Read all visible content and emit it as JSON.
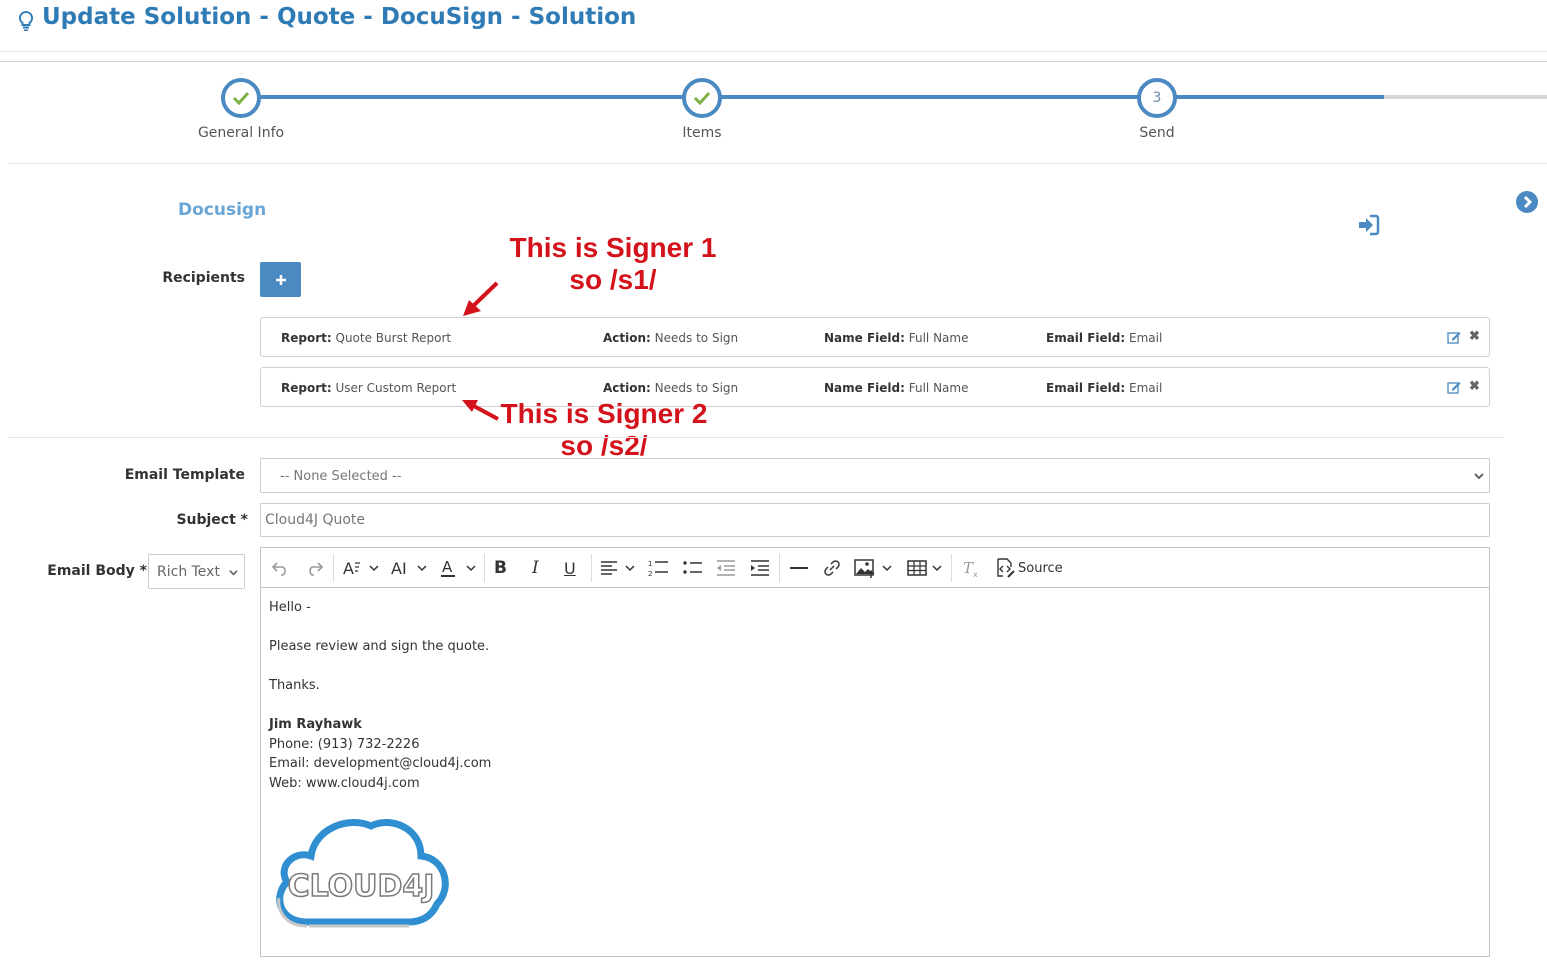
{
  "header": {
    "title": "Update Solution - Quote - DocuSign - Solution"
  },
  "wizard": {
    "steps": [
      {
        "label": "General Info",
        "state": "done"
      },
      {
        "label": "Items",
        "state": "done"
      },
      {
        "label": "Send",
        "state": "current",
        "number": "3"
      }
    ]
  },
  "section": {
    "title": "Docusign"
  },
  "recipients": {
    "label": "Recipients",
    "items": [
      {
        "report_key": "Report:",
        "report": "Quote Burst Report",
        "action_key": "Action:",
        "action": "Needs to Sign",
        "name_key": "Name Field:",
        "name": "Full Name",
        "email_key": "Email Field:",
        "email": "Email"
      },
      {
        "report_key": "Report:",
        "report": "User Custom Report",
        "action_key": "Action:",
        "action": "Needs to Sign",
        "name_key": "Name Field:",
        "name": "Full Name",
        "email_key": "Email Field:",
        "email": "Email"
      }
    ]
  },
  "annotations": {
    "signer1_line1": "This is Signer 1",
    "signer1_line2": "so /s1/",
    "signer2_line1": "This is Signer 2",
    "signer2_line2": "so /s2/"
  },
  "form": {
    "email_template": {
      "label": "Email Template",
      "value": "-- None Selected --"
    },
    "subject": {
      "label": "Subject",
      "required_mark": "*",
      "placeholder": "Cloud4J Quote"
    },
    "email_body": {
      "label": "Email Body",
      "required_mark": "*",
      "format": "Rich Text"
    }
  },
  "editor": {
    "toolbar": {
      "source_label": "Source"
    },
    "body": {
      "greeting": "Hello -",
      "message": "Please review and sign the quote.",
      "closing": "Thanks.",
      "signature_name": "Jim Rayhawk",
      "phone": "Phone: (913) 732-2226",
      "email": "Email: development@cloud4j.com",
      "web": "Web: www.cloud4j.com",
      "logo_text": "CLOUD4J"
    }
  },
  "colors": {
    "accent": "#4a89c1",
    "title": "#2f7bb6",
    "section": "#69a6d6",
    "annotation": "#d3121b",
    "check": "#7cb342"
  }
}
